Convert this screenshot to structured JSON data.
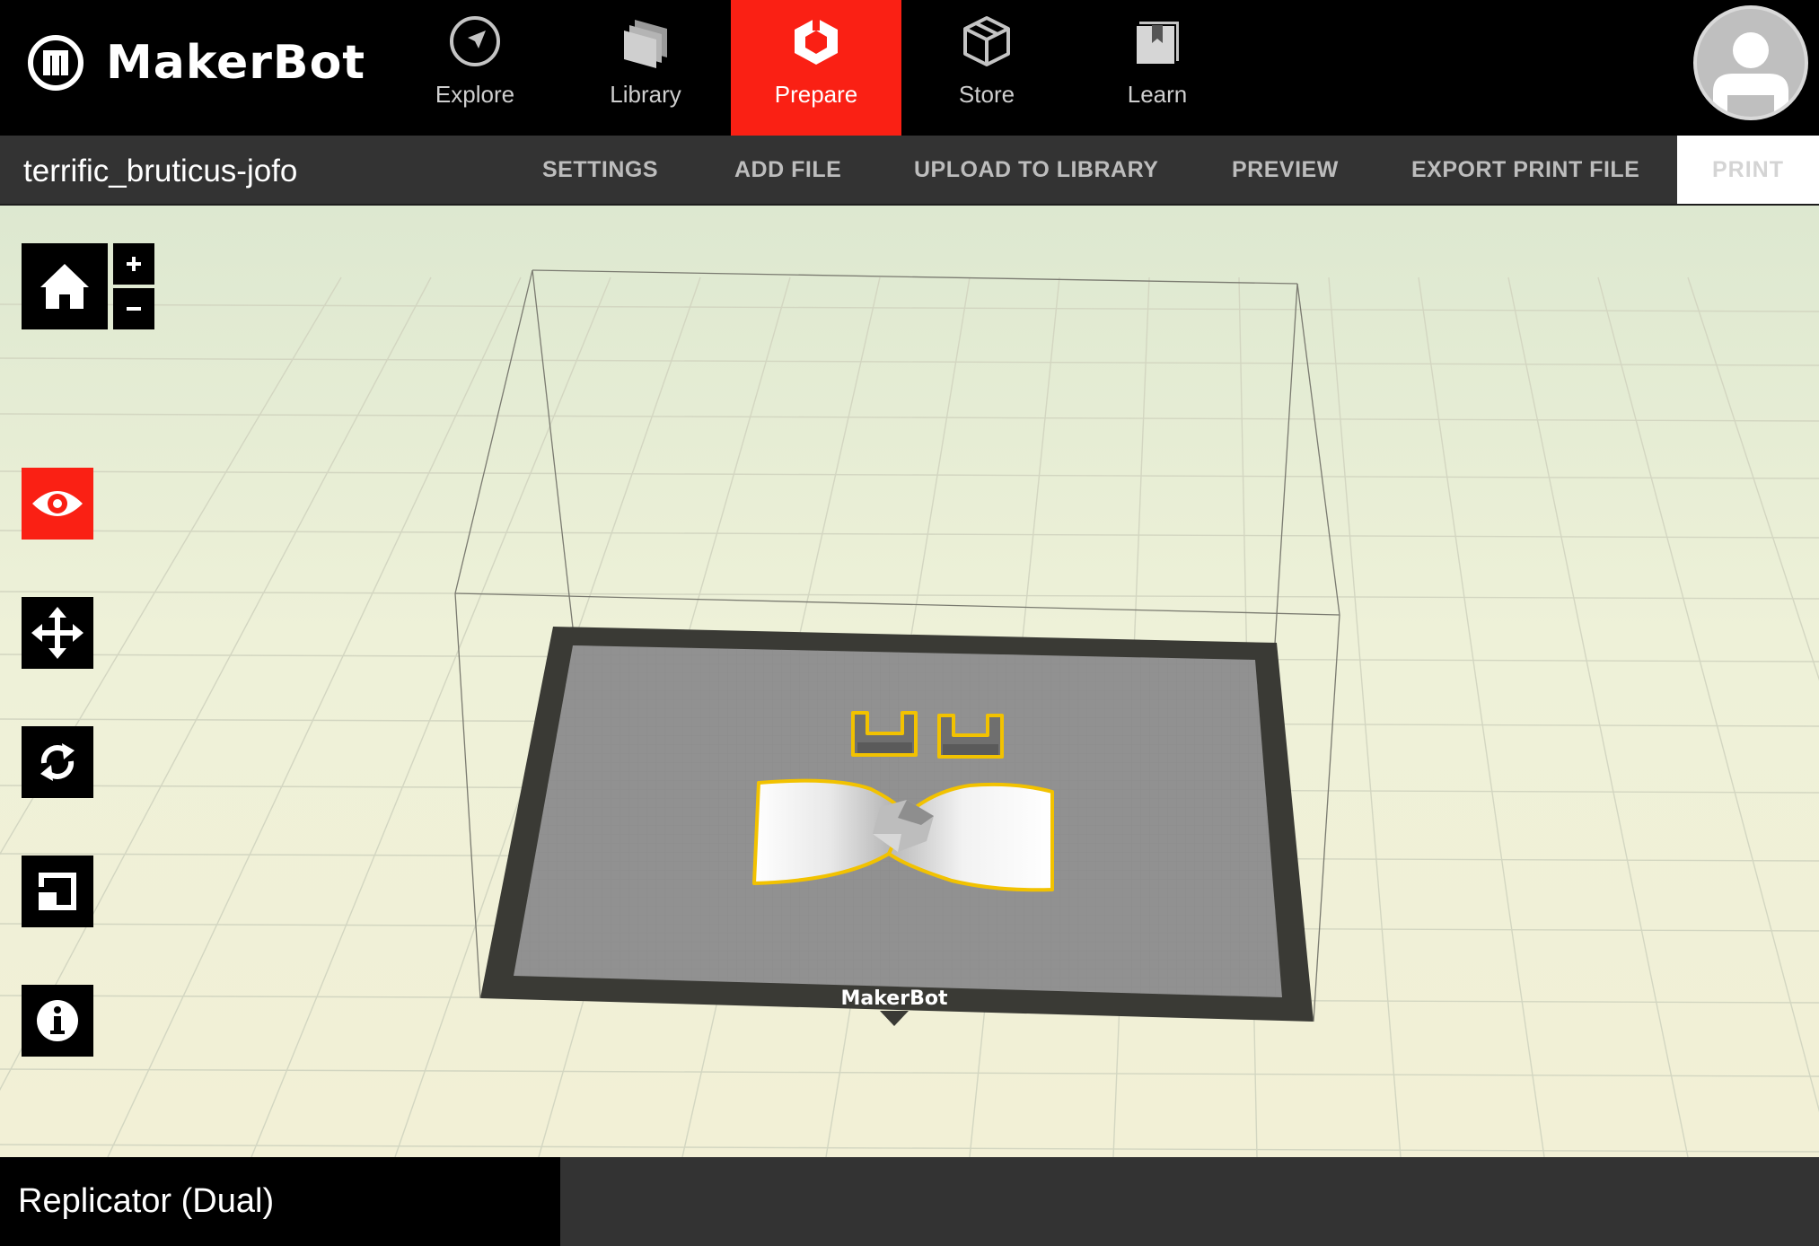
{
  "app": {
    "logo_text": "MakerBot"
  },
  "nav": {
    "tabs": [
      {
        "label": "Explore",
        "icon": "compass-icon"
      },
      {
        "label": "Library",
        "icon": "library-stack-icon"
      },
      {
        "label": "Prepare",
        "icon": "prepare-cube-icon",
        "active": true
      },
      {
        "label": "Store",
        "icon": "store-box-icon"
      },
      {
        "label": "Learn",
        "icon": "learn-book-icon"
      }
    ],
    "accent_color": "#fa2014"
  },
  "toolbar": {
    "project_name": "terrific_bruticus-jofo",
    "settings": "SETTINGS",
    "add_file": "ADD FILE",
    "upload": "UPLOAD TO LIBRARY",
    "preview": "PREVIEW",
    "export": "EXPORT PRINT FILE",
    "print": "PRINT"
  },
  "viewport": {
    "plate_brand": "MakerBot",
    "sidebar_icons": [
      "home-icon",
      "zoom-in-icon",
      "zoom-out-icon",
      "view-eye-icon",
      "move-icon",
      "rotate-icon",
      "scale-icon",
      "info-icon"
    ],
    "active_tool": "view-eye-icon",
    "selection_color": "#f2c200"
  },
  "status": {
    "printer": "Replicator (Dual)"
  }
}
